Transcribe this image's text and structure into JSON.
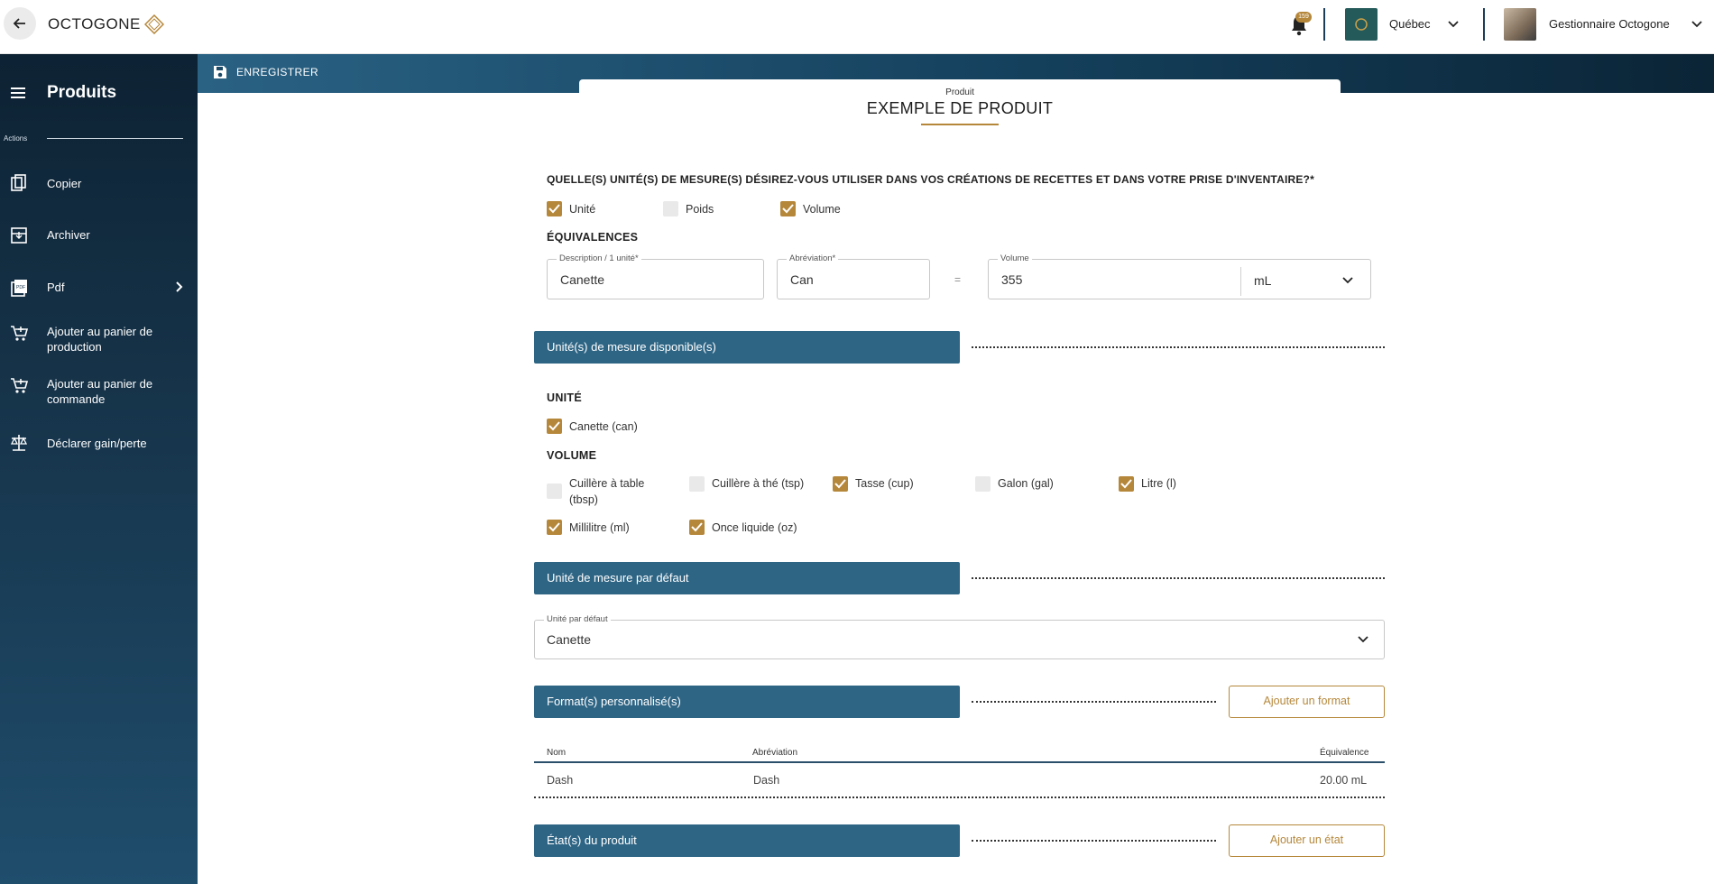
{
  "app": {
    "logo_text": "OCTOGONE",
    "notification_count": "159",
    "store_name": "Québec",
    "user_name": "Gestionnaire Octogone"
  },
  "sidebar": {
    "title": "Produits",
    "actions_label": "Actions",
    "items": [
      {
        "label": "Copier",
        "icon": "copy-icon"
      },
      {
        "label": "Archiver",
        "icon": "archive-icon"
      },
      {
        "label": "Pdf",
        "icon": "pdf-icon",
        "has_submenu": true
      },
      {
        "label": "Ajouter au panier de production",
        "icon": "add-cart-icon"
      },
      {
        "label": "Ajouter au panier de commande",
        "icon": "add-cart-icon"
      },
      {
        "label": "Déclarer gain/perte",
        "icon": "scale-icon"
      }
    ]
  },
  "toolbar": {
    "save_label": "ENREGISTRER"
  },
  "product": {
    "kicker": "Produit",
    "name": "EXEMPLE DE PRODUIT"
  },
  "measures": {
    "question": "QUELLE(S) UNITÉ(S) DE MESURE(S) DÉSIREZ-VOUS UTILISER DANS VOS CRÉATIONS DE RECETTES ET DANS VOTRE PRISE D'INVENTAIRE?*",
    "options": [
      {
        "label": "Unité",
        "checked": true
      },
      {
        "label": "Poids",
        "checked": false
      },
      {
        "label": "Volume",
        "checked": true
      }
    ]
  },
  "equivalences": {
    "title": "ÉQUIVALENCES",
    "description_label": "Description / 1 unité*",
    "description_value": "Canette",
    "abbreviation_label": "Abréviation*",
    "abbreviation_value": "Can",
    "equals": "=",
    "volume_label": "Volume",
    "volume_value": "355",
    "volume_unit": "mL"
  },
  "available_units": {
    "section_title": "Unité(s) de mesure disponible(s)",
    "unit_group_title": "UNITÉ",
    "unit_items": [
      {
        "label": "Canette (can)",
        "checked": true
      }
    ],
    "volume_group_title": "VOLUME",
    "volume_items": [
      {
        "label": "Cuillère à table (tbsp)",
        "checked": false
      },
      {
        "label": "Cuillère à thé (tsp)",
        "checked": false
      },
      {
        "label": "Tasse (cup)",
        "checked": true
      },
      {
        "label": "Galon (gal)",
        "checked": false
      },
      {
        "label": "Litre (l)",
        "checked": true
      },
      {
        "label": "Millilitre (ml)",
        "checked": true
      },
      {
        "label": "Once liquide (oz)",
        "checked": true
      }
    ]
  },
  "default_unit": {
    "section_title": "Unité de mesure par défaut",
    "field_label": "Unité par défaut",
    "value": "Canette"
  },
  "formats": {
    "section_title": "Format(s) personnalisé(s)",
    "add_button": "Ajouter un format",
    "columns": [
      "Nom",
      "Abréviation",
      "Équivalence"
    ],
    "rows": [
      {
        "name": "Dash",
        "abbreviation": "Dash",
        "equivalence": "20.00 mL"
      }
    ]
  },
  "states": {
    "section_title": "État(s) du produit",
    "add_button": "Ajouter un état"
  },
  "colors": {
    "accent": "#b5873a",
    "section_bar": "#2e6585",
    "sidebar_dark": "#0d2233"
  }
}
